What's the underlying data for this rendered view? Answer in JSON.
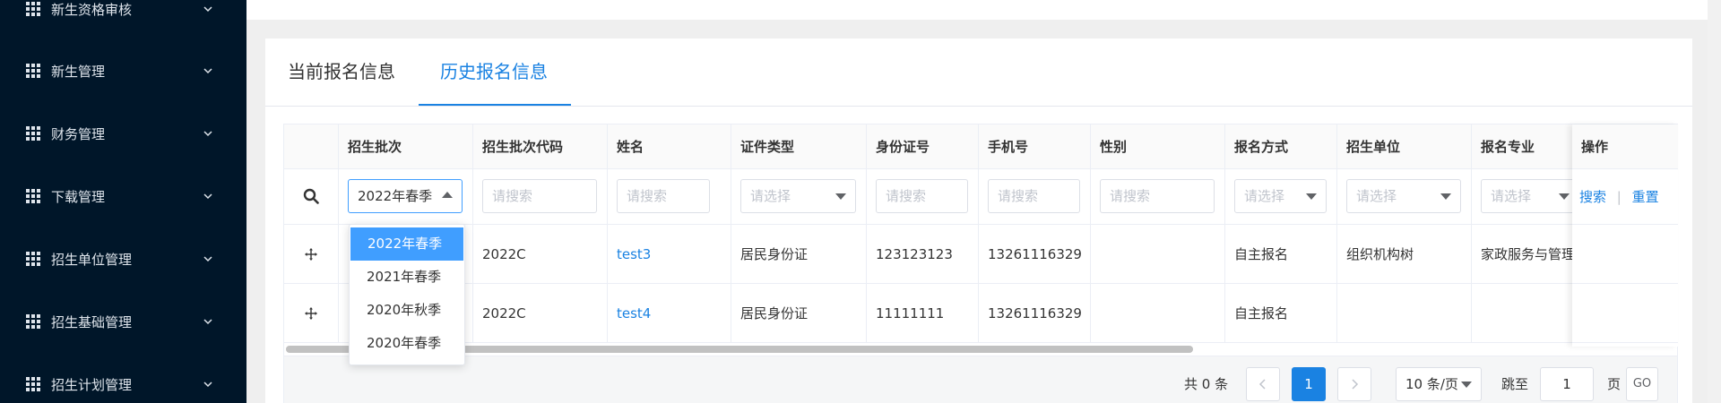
{
  "sidebar": {
    "items": [
      {
        "label": "新生资格审核"
      },
      {
        "label": "新生管理"
      },
      {
        "label": "财务管理"
      },
      {
        "label": "下载管理"
      },
      {
        "label": "招生单位管理"
      },
      {
        "label": "招生基础管理"
      },
      {
        "label": "招生计划管理"
      }
    ]
  },
  "tabs": [
    {
      "label": "当前报名信息",
      "active": false
    },
    {
      "label": "历史报名信息",
      "active": true
    }
  ],
  "table": {
    "columns": [
      "招生批次",
      "招生批次代码",
      "姓名",
      "证件类型",
      "身份证号",
      "手机号",
      "性别",
      "报名方式",
      "招生单位",
      "报名专业",
      "操作"
    ],
    "filters": {
      "batch_value": "2022年春季",
      "search_placeholder": "请搜索",
      "select_placeholder": "请选择",
      "search_label": "搜索",
      "reset_label": "重置",
      "separator": "|"
    },
    "rows": [
      {
        "batch_code": "2022C",
        "name": "test3",
        "id_type": "居民身份证",
        "id_number": "123123123",
        "phone": "13261116329",
        "gender": "",
        "signup_method": "自主报名",
        "unit": "组织机构树",
        "major": "家政服务与管理"
      },
      {
        "batch_code": "2022C",
        "name": "test4",
        "id_type": "居民身份证",
        "id_number": "11111111",
        "phone": "13261116329",
        "gender": "",
        "signup_method": "自主报名",
        "unit": "",
        "major": ""
      }
    ]
  },
  "dropdown": {
    "options": [
      "2022年春季",
      "2021年春季",
      "2020年秋季",
      "2020年春季"
    ],
    "selected_index": 0
  },
  "pagination": {
    "total_text": "共 0 条",
    "prev": "<",
    "current_page": "1",
    "next": ">",
    "page_size": "10 条/页",
    "jump_label": "跳至",
    "jump_value": "1",
    "page_unit": "页",
    "go_label": "GO"
  },
  "colors": {
    "sidebar_bg": "#001629",
    "accent": "#1a82e2",
    "option_selected_bg": "#409eff"
  }
}
